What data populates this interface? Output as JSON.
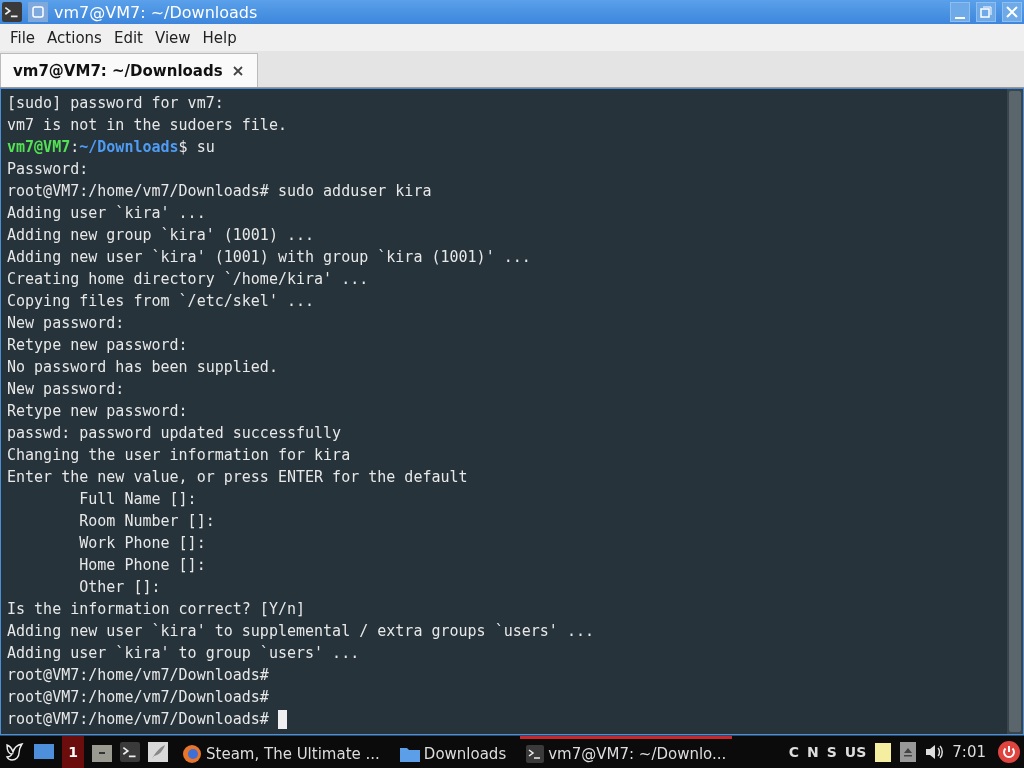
{
  "window": {
    "title": "vm7@VM7: ~/Downloads"
  },
  "menu": [
    "File",
    "Actions",
    "Edit",
    "View",
    "Help"
  ],
  "tabs": [
    {
      "label": "vm7@VM7: ~/Downloads",
      "selected": true
    }
  ],
  "terminal": {
    "lines": [
      {
        "kind": "plain",
        "text": "[sudo] password for vm7:"
      },
      {
        "kind": "plain",
        "text": "vm7 is not in the sudoers file."
      },
      {
        "kind": "user_prompt",
        "user": "vm7@VM7",
        "sep": ":",
        "path": "~/Downloads",
        "end": "$",
        "command": " su"
      },
      {
        "kind": "plain",
        "text": "Password:"
      },
      {
        "kind": "plain",
        "text": "root@VM7:/home/vm7/Downloads# sudo adduser kira"
      },
      {
        "kind": "plain",
        "text": "Adding user `kira' ..."
      },
      {
        "kind": "plain",
        "text": "Adding new group `kira' (1001) ..."
      },
      {
        "kind": "plain",
        "text": "Adding new user `kira' (1001) with group `kira (1001)' ..."
      },
      {
        "kind": "plain",
        "text": "Creating home directory `/home/kira' ..."
      },
      {
        "kind": "plain",
        "text": "Copying files from `/etc/skel' ..."
      },
      {
        "kind": "plain",
        "text": "New password:"
      },
      {
        "kind": "plain",
        "text": "Retype new password:"
      },
      {
        "kind": "plain",
        "text": "No password has been supplied."
      },
      {
        "kind": "plain",
        "text": "New password:"
      },
      {
        "kind": "plain",
        "text": "Retype new password:"
      },
      {
        "kind": "plain",
        "text": "passwd: password updated successfully"
      },
      {
        "kind": "plain",
        "text": "Changing the user information for kira"
      },
      {
        "kind": "plain",
        "text": "Enter the new value, or press ENTER for the default"
      },
      {
        "kind": "plain",
        "text": "        Full Name []:"
      },
      {
        "kind": "plain",
        "text": "        Room Number []:"
      },
      {
        "kind": "plain",
        "text": "        Work Phone []:"
      },
      {
        "kind": "plain",
        "text": "        Home Phone []:"
      },
      {
        "kind": "plain",
        "text": "        Other []:"
      },
      {
        "kind": "plain",
        "text": "Is the information correct? [Y/n]"
      },
      {
        "kind": "plain",
        "text": "Adding new user `kira' to supplemental / extra groups `users' ..."
      },
      {
        "kind": "plain",
        "text": "Adding user `kira' to group `users' ..."
      },
      {
        "kind": "plain",
        "text": "root@VM7:/home/vm7/Downloads#"
      },
      {
        "kind": "plain",
        "text": "root@VM7:/home/vm7/Downloads#"
      },
      {
        "kind": "cursor",
        "text": "root@VM7:/home/vm7/Downloads# "
      }
    ]
  },
  "taskbar": {
    "workspace": "1",
    "tasks": [
      {
        "kind": "browser",
        "label": "Steam, The Ultimate ...",
        "selected": false
      },
      {
        "kind": "folder",
        "label": "Downloads",
        "selected": false
      },
      {
        "kind": "terminal",
        "label": "vm7@VM7: ~/Downlo...",
        "selected": true
      }
    ],
    "keyboard": [
      "C",
      "N",
      "S",
      "US"
    ],
    "clock": "7:01"
  }
}
